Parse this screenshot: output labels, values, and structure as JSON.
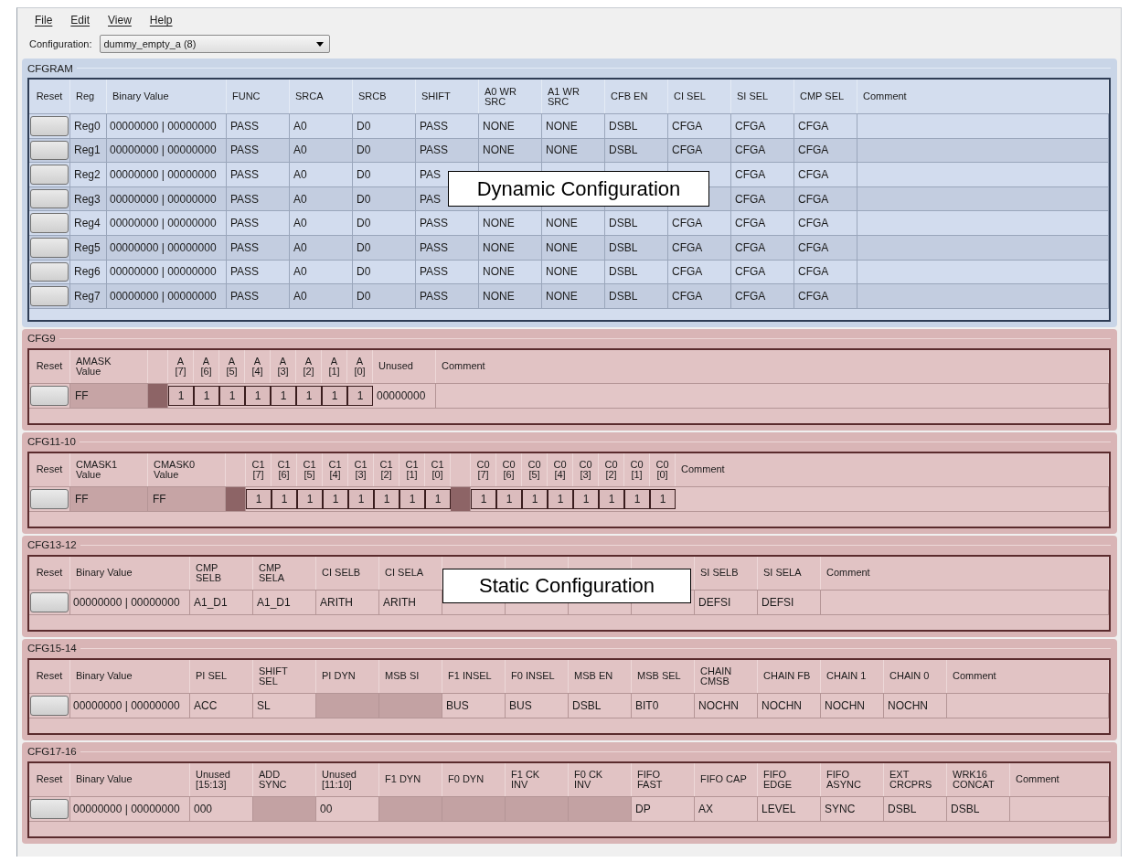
{
  "menu": [
    {
      "label": "File"
    },
    {
      "label": "Edit"
    },
    {
      "label": "View"
    },
    {
      "label": "Help"
    }
  ],
  "configuration": {
    "label": "Configuration:",
    "value": "dummy_empty_a (8)"
  },
  "sections": [
    {
      "title": "CFGRAM",
      "kind": "dynamic",
      "callout": "Dynamic Configuration",
      "columns": [
        {
          "label": "Reset",
          "kind": "reset"
        },
        {
          "label": "Reg",
          "kind": "name"
        },
        {
          "label": "Binary Value",
          "kind": "binary"
        },
        {
          "label": "FUNC",
          "kind": "field"
        },
        {
          "label": "SRCA",
          "kind": "field"
        },
        {
          "label": "SRCB",
          "kind": "field"
        },
        {
          "label": "SHIFT",
          "kind": "field"
        },
        {
          "label": "A0 WR\nSRC",
          "kind": "field"
        },
        {
          "label": "A1 WR\nSRC",
          "kind": "field"
        },
        {
          "label": "CFB EN",
          "kind": "field"
        },
        {
          "label": "CI SEL",
          "kind": "field"
        },
        {
          "label": "SI SEL",
          "kind": "field"
        },
        {
          "label": "CMP SEL",
          "kind": "field"
        },
        {
          "label": "Comment",
          "kind": "comment"
        }
      ],
      "rows": [
        {
          "cells": [
            {
              "kind": "reset"
            },
            {
              "kind": "text",
              "text": "Reg0"
            },
            {
              "kind": "text",
              "text": "00000000  |  00000000"
            },
            {
              "kind": "text",
              "text": "PASS"
            },
            {
              "kind": "text",
              "text": "A0"
            },
            {
              "kind": "text",
              "text": "D0"
            },
            {
              "kind": "text",
              "text": "PASS"
            },
            {
              "kind": "text",
              "text": "NONE"
            },
            {
              "kind": "text",
              "text": "NONE"
            },
            {
              "kind": "text",
              "text": "DSBL"
            },
            {
              "kind": "text",
              "text": "CFGA"
            },
            {
              "kind": "text",
              "text": "CFGA"
            },
            {
              "kind": "text",
              "text": "CFGA"
            },
            {
              "kind": "text"
            }
          ]
        },
        {
          "cells": [
            {
              "kind": "reset"
            },
            {
              "kind": "text",
              "text": "Reg1"
            },
            {
              "kind": "text",
              "text": "00000000  |  00000000"
            },
            {
              "kind": "text",
              "text": "PASS"
            },
            {
              "kind": "text",
              "text": "A0"
            },
            {
              "kind": "text",
              "text": "D0"
            },
            {
              "kind": "text",
              "text": "PASS"
            },
            {
              "kind": "text",
              "text": "NONE"
            },
            {
              "kind": "text",
              "text": "NONE"
            },
            {
              "kind": "text",
              "text": "DSBL"
            },
            {
              "kind": "text",
              "text": "CFGA"
            },
            {
              "kind": "text",
              "text": "CFGA"
            },
            {
              "kind": "text",
              "text": "CFGA"
            },
            {
              "kind": "text"
            }
          ]
        },
        {
          "cells": [
            {
              "kind": "reset"
            },
            {
              "kind": "text",
              "text": "Reg2"
            },
            {
              "kind": "text",
              "text": "00000000  |  00000000"
            },
            {
              "kind": "text",
              "text": "PASS"
            },
            {
              "kind": "text",
              "text": "A0"
            },
            {
              "kind": "text",
              "text": "D0"
            },
            {
              "kind": "text",
              "text": "PAS"
            },
            {
              "kind": "text"
            },
            {
              "kind": "text"
            },
            {
              "kind": "text"
            },
            {
              "kind": "text"
            },
            {
              "kind": "text",
              "text": "CFGA"
            },
            {
              "kind": "text",
              "text": "CFGA"
            },
            {
              "kind": "text"
            }
          ]
        },
        {
          "cells": [
            {
              "kind": "reset"
            },
            {
              "kind": "text",
              "text": "Reg3"
            },
            {
              "kind": "text",
              "text": "00000000  |  00000000"
            },
            {
              "kind": "text",
              "text": "PASS"
            },
            {
              "kind": "text",
              "text": "A0"
            },
            {
              "kind": "text",
              "text": "D0"
            },
            {
              "kind": "text",
              "text": "PAS"
            },
            {
              "kind": "text"
            },
            {
              "kind": "text"
            },
            {
              "kind": "text"
            },
            {
              "kind": "text"
            },
            {
              "kind": "text",
              "text": "CFGA"
            },
            {
              "kind": "text",
              "text": "CFGA"
            },
            {
              "kind": "text"
            }
          ]
        },
        {
          "cells": [
            {
              "kind": "reset"
            },
            {
              "kind": "text",
              "text": "Reg4"
            },
            {
              "kind": "text",
              "text": "00000000  |  00000000"
            },
            {
              "kind": "text",
              "text": "PASS"
            },
            {
              "kind": "text",
              "text": "A0"
            },
            {
              "kind": "text",
              "text": "D0"
            },
            {
              "kind": "text",
              "text": "PASS"
            },
            {
              "kind": "text",
              "text": "NONE"
            },
            {
              "kind": "text",
              "text": "NONE"
            },
            {
              "kind": "text",
              "text": "DSBL"
            },
            {
              "kind": "text",
              "text": "CFGA"
            },
            {
              "kind": "text",
              "text": "CFGA"
            },
            {
              "kind": "text",
              "text": "CFGA"
            },
            {
              "kind": "text"
            }
          ]
        },
        {
          "cells": [
            {
              "kind": "reset"
            },
            {
              "kind": "text",
              "text": "Reg5"
            },
            {
              "kind": "text",
              "text": "00000000  |  00000000"
            },
            {
              "kind": "text",
              "text": "PASS"
            },
            {
              "kind": "text",
              "text": "A0"
            },
            {
              "kind": "text",
              "text": "D0"
            },
            {
              "kind": "text",
              "text": "PASS"
            },
            {
              "kind": "text",
              "text": "NONE"
            },
            {
              "kind": "text",
              "text": "NONE"
            },
            {
              "kind": "text",
              "text": "DSBL"
            },
            {
              "kind": "text",
              "text": "CFGA"
            },
            {
              "kind": "text",
              "text": "CFGA"
            },
            {
              "kind": "text",
              "text": "CFGA"
            },
            {
              "kind": "text"
            }
          ]
        },
        {
          "cells": [
            {
              "kind": "reset"
            },
            {
              "kind": "text",
              "text": "Reg6"
            },
            {
              "kind": "text",
              "text": "00000000  |  00000000"
            },
            {
              "kind": "text",
              "text": "PASS"
            },
            {
              "kind": "text",
              "text": "A0"
            },
            {
              "kind": "text",
              "text": "D0"
            },
            {
              "kind": "text",
              "text": "PASS"
            },
            {
              "kind": "text",
              "text": "NONE"
            },
            {
              "kind": "text",
              "text": "NONE"
            },
            {
              "kind": "text",
              "text": "DSBL"
            },
            {
              "kind": "text",
              "text": "CFGA"
            },
            {
              "kind": "text",
              "text": "CFGA"
            },
            {
              "kind": "text",
              "text": "CFGA"
            },
            {
              "kind": "text"
            }
          ]
        },
        {
          "cells": [
            {
              "kind": "reset"
            },
            {
              "kind": "text",
              "text": "Reg7"
            },
            {
              "kind": "text",
              "text": "00000000  |  00000000"
            },
            {
              "kind": "text",
              "text": "PASS"
            },
            {
              "kind": "text",
              "text": "A0"
            },
            {
              "kind": "text",
              "text": "D0"
            },
            {
              "kind": "text",
              "text": "PASS"
            },
            {
              "kind": "text",
              "text": "NONE"
            },
            {
              "kind": "text",
              "text": "NONE"
            },
            {
              "kind": "text",
              "text": "DSBL"
            },
            {
              "kind": "text",
              "text": "CFGA"
            },
            {
              "kind": "text",
              "text": "CFGA"
            },
            {
              "kind": "text",
              "text": "CFGA"
            },
            {
              "kind": "text"
            }
          ]
        }
      ]
    },
    {
      "title": "CFG9",
      "kind": "static",
      "columns": [
        {
          "label": "Reset",
          "kind": "reset"
        },
        {
          "label": "AMASK\nValue",
          "kind": "value"
        },
        {
          "kind": "spacer"
        },
        {
          "label": "A\n[7]",
          "kind": "bit"
        },
        {
          "label": "A\n[6]",
          "kind": "bit"
        },
        {
          "label": "A\n[5]",
          "kind": "bit"
        },
        {
          "label": "A\n[4]",
          "kind": "bit"
        },
        {
          "label": "A\n[3]",
          "kind": "bit"
        },
        {
          "label": "A\n[2]",
          "kind": "bit"
        },
        {
          "label": "A\n[1]",
          "kind": "bit"
        },
        {
          "label": "A\n[0]",
          "kind": "bit"
        },
        {
          "label": "Unused",
          "kind": "field"
        },
        {
          "label": "Comment",
          "kind": "comment"
        }
      ],
      "rows": [
        {
          "cells": [
            {
              "kind": "reset"
            },
            {
              "kind": "readonly",
              "text": "FF"
            },
            {
              "kind": "spacer"
            },
            {
              "kind": "bit",
              "text": "1"
            },
            {
              "kind": "bit",
              "text": "1"
            },
            {
              "kind": "bit",
              "text": "1"
            },
            {
              "kind": "bit",
              "text": "1"
            },
            {
              "kind": "bit",
              "text": "1"
            },
            {
              "kind": "bit",
              "text": "1"
            },
            {
              "kind": "bit",
              "text": "1"
            },
            {
              "kind": "bit",
              "text": "1"
            },
            {
              "kind": "text",
              "text": "00000000"
            },
            {
              "kind": "text"
            }
          ]
        }
      ]
    },
    {
      "title": "CFG11-10",
      "kind": "static",
      "columns": [
        {
          "label": "Reset",
          "kind": "reset"
        },
        {
          "label": "CMASK1\nValue",
          "kind": "value"
        },
        {
          "label": "CMASK0\nValue",
          "kind": "value"
        },
        {
          "kind": "spacer"
        },
        {
          "label": "C1\n[7]",
          "kind": "bit"
        },
        {
          "label": "C1\n[6]",
          "kind": "bit"
        },
        {
          "label": "C1\n[5]",
          "kind": "bit"
        },
        {
          "label": "C1\n[4]",
          "kind": "bit"
        },
        {
          "label": "C1\n[3]",
          "kind": "bit"
        },
        {
          "label": "C1\n[2]",
          "kind": "bit"
        },
        {
          "label": "C1\n[1]",
          "kind": "bit"
        },
        {
          "label": "C1\n[0]",
          "kind": "bit"
        },
        {
          "kind": "spacer"
        },
        {
          "label": "C0\n[7]",
          "kind": "bit"
        },
        {
          "label": "C0\n[6]",
          "kind": "bit"
        },
        {
          "label": "C0\n[5]",
          "kind": "bit"
        },
        {
          "label": "C0\n[4]",
          "kind": "bit"
        },
        {
          "label": "C0\n[3]",
          "kind": "bit"
        },
        {
          "label": "C0\n[2]",
          "kind": "bit"
        },
        {
          "label": "C0\n[1]",
          "kind": "bit"
        },
        {
          "label": "C0\n[0]",
          "kind": "bit"
        },
        {
          "label": "Comment",
          "kind": "comment"
        }
      ],
      "rows": [
        {
          "cells": [
            {
              "kind": "reset"
            },
            {
              "kind": "readonly",
              "text": "FF"
            },
            {
              "kind": "readonly",
              "text": "FF"
            },
            {
              "kind": "spacer"
            },
            {
              "kind": "bit",
              "text": "1"
            },
            {
              "kind": "bit",
              "text": "1"
            },
            {
              "kind": "bit",
              "text": "1"
            },
            {
              "kind": "bit",
              "text": "1"
            },
            {
              "kind": "bit",
              "text": "1"
            },
            {
              "kind": "bit",
              "text": "1"
            },
            {
              "kind": "bit",
              "text": "1"
            },
            {
              "kind": "bit",
              "text": "1"
            },
            {
              "kind": "spacer"
            },
            {
              "kind": "bit",
              "text": "1"
            },
            {
              "kind": "bit",
              "text": "1"
            },
            {
              "kind": "bit",
              "text": "1"
            },
            {
              "kind": "bit",
              "text": "1"
            },
            {
              "kind": "bit",
              "text": "1"
            },
            {
              "kind": "bit",
              "text": "1"
            },
            {
              "kind": "bit",
              "text": "1"
            },
            {
              "kind": "bit",
              "text": "1"
            },
            {
              "kind": "text"
            }
          ]
        }
      ]
    },
    {
      "title": "CFG13-12",
      "kind": "static",
      "callout": "Static Configuration",
      "columns": [
        {
          "label": "Reset",
          "kind": "reset"
        },
        {
          "label": "Binary Value",
          "kind": "binary"
        },
        {
          "label": "CMP\nSELB",
          "kind": "field"
        },
        {
          "label": "CMP\nSELA",
          "kind": "field"
        },
        {
          "label": "CI SELB",
          "kind": "field"
        },
        {
          "label": "CI SELA",
          "kind": "field"
        },
        {
          "kind": "field"
        },
        {
          "kind": "field"
        },
        {
          "kind": "field"
        },
        {
          "kind": "field"
        },
        {
          "label": "SI SELB",
          "kind": "field"
        },
        {
          "label": "SI SELA",
          "kind": "field"
        },
        {
          "label": "Comment",
          "kind": "comment"
        }
      ],
      "rows": [
        {
          "cells": [
            {
              "kind": "reset"
            },
            {
              "kind": "text",
              "text": "00000000  |  00000000"
            },
            {
              "kind": "text",
              "text": "A1_D1"
            },
            {
              "kind": "text",
              "text": "A1_D1"
            },
            {
              "kind": "text",
              "text": "ARITH"
            },
            {
              "kind": "text",
              "text": "ARITH"
            },
            {
              "kind": "text"
            },
            {
              "kind": "text"
            },
            {
              "kind": "text"
            },
            {
              "kind": "text"
            },
            {
              "kind": "text",
              "text": "DEFSI"
            },
            {
              "kind": "text",
              "text": "DEFSI"
            },
            {
              "kind": "text"
            }
          ]
        }
      ]
    },
    {
      "title": "CFG15-14",
      "kind": "static",
      "columns": [
        {
          "label": "Reset",
          "kind": "reset"
        },
        {
          "label": "Binary Value",
          "kind": "binary"
        },
        {
          "label": "PI SEL",
          "kind": "field"
        },
        {
          "label": "SHIFT\nSEL",
          "kind": "field"
        },
        {
          "label": "PI DYN",
          "kind": "field"
        },
        {
          "label": "MSB SI",
          "kind": "field"
        },
        {
          "label": "F1 INSEL",
          "kind": "field"
        },
        {
          "label": "F0 INSEL",
          "kind": "field"
        },
        {
          "label": "MSB EN",
          "kind": "field"
        },
        {
          "label": "MSB SEL",
          "kind": "field"
        },
        {
          "label": "CHAIN\nCMSB",
          "kind": "field"
        },
        {
          "label": "CHAIN FB",
          "kind": "field"
        },
        {
          "label": "CHAIN 1",
          "kind": "field"
        },
        {
          "label": "CHAIN 0",
          "kind": "field"
        },
        {
          "label": "Comment",
          "kind": "comment"
        }
      ],
      "rows": [
        {
          "cells": [
            {
              "kind": "reset"
            },
            {
              "kind": "text",
              "text": "00000000  |  00000000"
            },
            {
              "kind": "text",
              "text": "ACC"
            },
            {
              "kind": "text",
              "text": "SL"
            },
            {
              "kind": "blank"
            },
            {
              "kind": "blank"
            },
            {
              "kind": "text",
              "text": "BUS"
            },
            {
              "kind": "text",
              "text": "BUS"
            },
            {
              "kind": "text",
              "text": "DSBL"
            },
            {
              "kind": "text",
              "text": "BIT0"
            },
            {
              "kind": "text",
              "text": "NOCHN"
            },
            {
              "kind": "text",
              "text": "NOCHN"
            },
            {
              "kind": "text",
              "text": "NOCHN"
            },
            {
              "kind": "text",
              "text": "NOCHN"
            },
            {
              "kind": "text"
            }
          ]
        }
      ]
    },
    {
      "title": "CFG17-16",
      "kind": "static",
      "columns": [
        {
          "label": "Reset",
          "kind": "reset"
        },
        {
          "label": "Binary Value",
          "kind": "binary"
        },
        {
          "label": "Unused\n[15:13]",
          "kind": "field"
        },
        {
          "label": "ADD\nSYNC",
          "kind": "field"
        },
        {
          "label": "Unused\n[11:10]",
          "kind": "field"
        },
        {
          "label": "F1 DYN",
          "kind": "field"
        },
        {
          "label": "F0 DYN",
          "kind": "field"
        },
        {
          "label": "F1 CK\nINV",
          "kind": "field"
        },
        {
          "label": "F0 CK\nINV",
          "kind": "field"
        },
        {
          "label": "FIFO\nFAST",
          "kind": "field"
        },
        {
          "label": "FIFO CAP",
          "kind": "field"
        },
        {
          "label": "FIFO\nEDGE",
          "kind": "field"
        },
        {
          "label": "FIFO\nASYNC",
          "kind": "field"
        },
        {
          "label": "EXT\nCRCPRS",
          "kind": "field"
        },
        {
          "label": "WRK16\nCONCAT",
          "kind": "field"
        },
        {
          "label": "Comment",
          "kind": "comment"
        }
      ],
      "rows": [
        {
          "cells": [
            {
              "kind": "reset"
            },
            {
              "kind": "text",
              "text": "00000000  |  00000000"
            },
            {
              "kind": "text",
              "text": "000"
            },
            {
              "kind": "blank"
            },
            {
              "kind": "text",
              "text": "00"
            },
            {
              "kind": "blank"
            },
            {
              "kind": "blank"
            },
            {
              "kind": "blank"
            },
            {
              "kind": "blank"
            },
            {
              "kind": "text",
              "text": "DP"
            },
            {
              "kind": "text",
              "text": "AX"
            },
            {
              "kind": "text",
              "text": "LEVEL"
            },
            {
              "kind": "text",
              "text": "SYNC"
            },
            {
              "kind": "text",
              "text": "DSBL"
            },
            {
              "kind": "text",
              "text": "DSBL"
            },
            {
              "kind": "text"
            }
          ]
        }
      ]
    }
  ]
}
